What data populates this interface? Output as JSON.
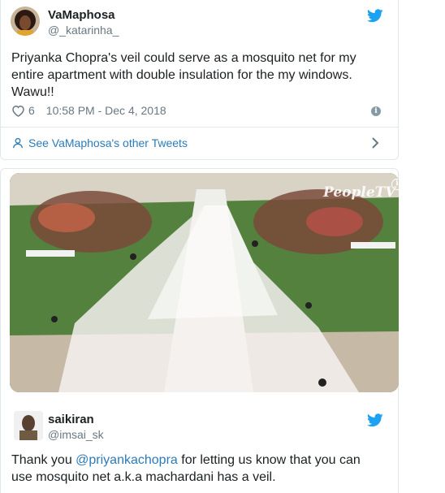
{
  "tweet1": {
    "display_name": "VaMaphosa",
    "handle": "@_katarinha_",
    "text": "Priyanka Chopra's veil could serve as a mosquito net for my entire apartment with double insulation for the my windows. Wawu!!",
    "likes": "6",
    "timestamp": "10:58 PM - Dec 4, 2018",
    "see_more": "See VaMaphosa's other Tweets"
  },
  "tweet2": {
    "watermark": "PeopleTV",
    "display_name": "saikiran",
    "handle": "@imsai_sk",
    "text_before": "Thank you ",
    "mention": "@priyankachopra",
    "text_after": " for letting us know that you can use mosquito net a.k.a machardani has a veil."
  },
  "colors": {
    "twitter_blue": "#1da1f2",
    "link_blue": "#2b7bb9",
    "secondary_text": "#697882",
    "border": "#e1e8ed"
  },
  "icons": [
    "twitter-bird-icon",
    "heart-icon",
    "info-icon",
    "person-icon",
    "chevron-right-icon"
  ]
}
